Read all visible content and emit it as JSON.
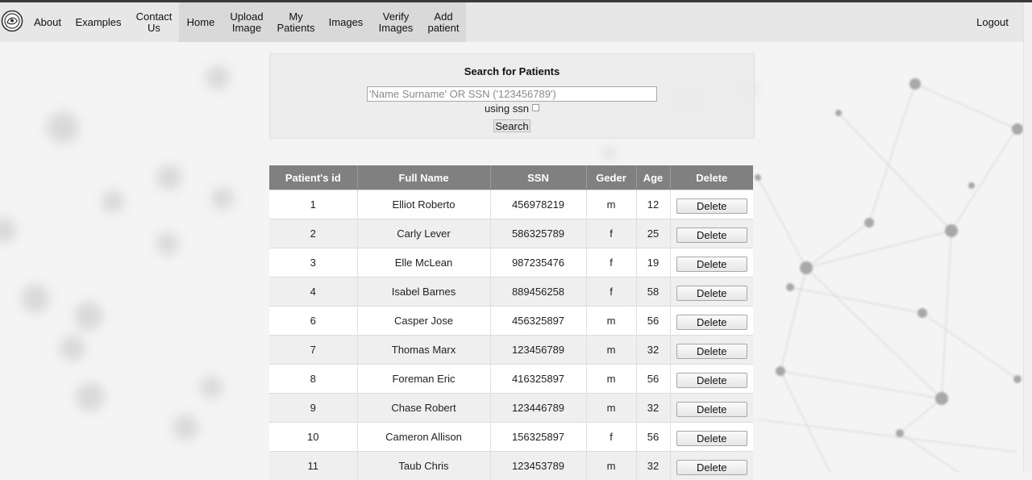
{
  "nav": {
    "logo_icon": "clinic-logo-icon",
    "items": [
      {
        "label": "About",
        "active": false
      },
      {
        "label": "Examples",
        "active": false
      },
      {
        "label": "Contact Us",
        "active": false
      },
      {
        "label": "Home",
        "active": true
      },
      {
        "label": "Upload Image",
        "active": true
      },
      {
        "label": "My Patients",
        "active": true
      },
      {
        "label": "Images",
        "active": true
      },
      {
        "label": "Verify Images",
        "active": true
      },
      {
        "label": "Add patient",
        "active": true
      }
    ],
    "logout": "Logout"
  },
  "search": {
    "title": "Search for Patients",
    "placeholder": "'Name Surname' OR SSN ('123456789')",
    "value": "",
    "ssn_label": "using ssn",
    "ssn_checked": false,
    "button": "Search"
  },
  "table": {
    "headers": [
      "Patient's id",
      "Full Name",
      "SSN",
      "Geder",
      "Age",
      "Delete"
    ],
    "delete_label": "Delete",
    "rows": [
      {
        "id": "1",
        "name": "Elliot Roberto",
        "ssn": "456978219",
        "gender": "m",
        "age": "12"
      },
      {
        "id": "2",
        "name": "Carly Lever",
        "ssn": "586325789",
        "gender": "f",
        "age": "25"
      },
      {
        "id": "3",
        "name": "Elle McLean",
        "ssn": "987235476",
        "gender": "f",
        "age": "19"
      },
      {
        "id": "4",
        "name": "Isabel Barnes",
        "ssn": "889456258",
        "gender": "f",
        "age": "58"
      },
      {
        "id": "6",
        "name": "Casper Jose",
        "ssn": "456325897",
        "gender": "m",
        "age": "56"
      },
      {
        "id": "7",
        "name": "Thomas Marx",
        "ssn": "123456789",
        "gender": "m",
        "age": "32"
      },
      {
        "id": "8",
        "name": "Foreman Eric",
        "ssn": "416325897",
        "gender": "m",
        "age": "56"
      },
      {
        "id": "9",
        "name": "Chase Robert",
        "ssn": "123446789",
        "gender": "m",
        "age": "32"
      },
      {
        "id": "10",
        "name": "Cameron Allison",
        "ssn": "156325897",
        "gender": "f",
        "age": "56"
      },
      {
        "id": "11",
        "name": "Taub Chris",
        "ssn": "123453789",
        "gender": "m",
        "age": "32"
      }
    ]
  },
  "colors": {
    "navbar": "#e7e7e7",
    "navbar_active": "#d9d9d9",
    "table_header": "#808080",
    "top_line": "#3a3a3a"
  }
}
